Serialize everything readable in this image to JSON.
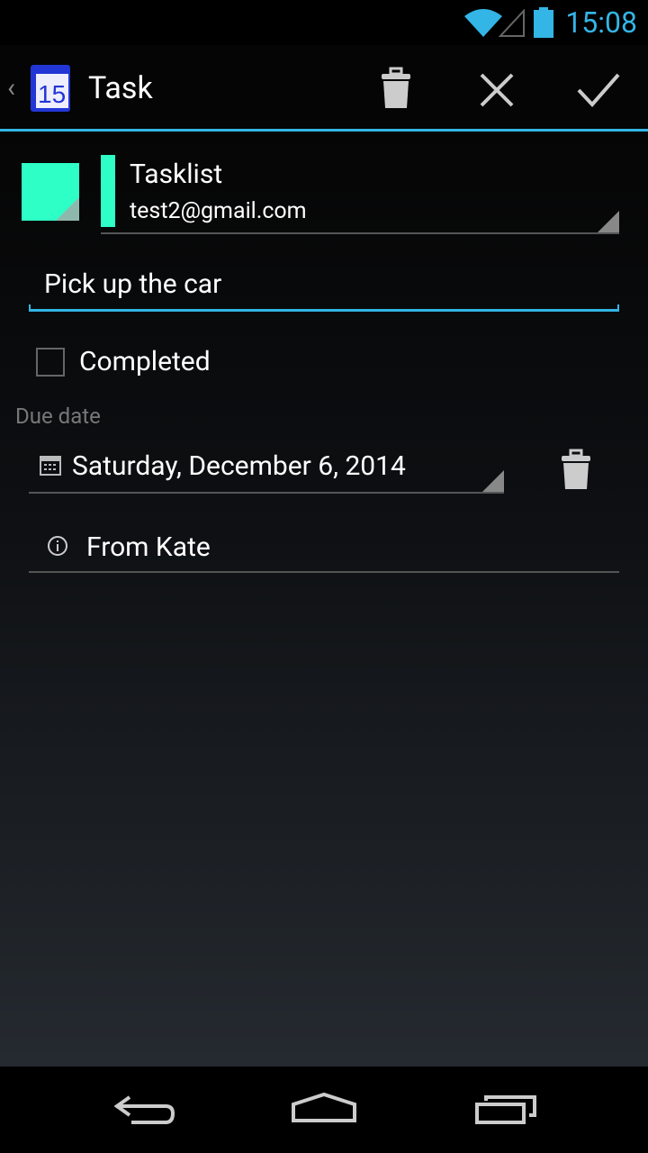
{
  "status_bar": {
    "time": "15:08",
    "icons": [
      "wifi-icon",
      "signal-icon",
      "battery-icon"
    ]
  },
  "action_bar": {
    "title": "Task",
    "actions": [
      "delete-icon",
      "discard-icon",
      "done-icon"
    ]
  },
  "colors": {
    "accent": "#33b5e5",
    "list_color": "#2effc6"
  },
  "tasklist": {
    "name": "Tasklist",
    "account": "test2@gmail.com"
  },
  "title_field": {
    "value": "Pick up the car"
  },
  "completed": {
    "label": "Completed",
    "checked": false
  },
  "due": {
    "label": "Due date",
    "value": "Saturday, December 6, 2014"
  },
  "note": {
    "value": "From Kate"
  }
}
